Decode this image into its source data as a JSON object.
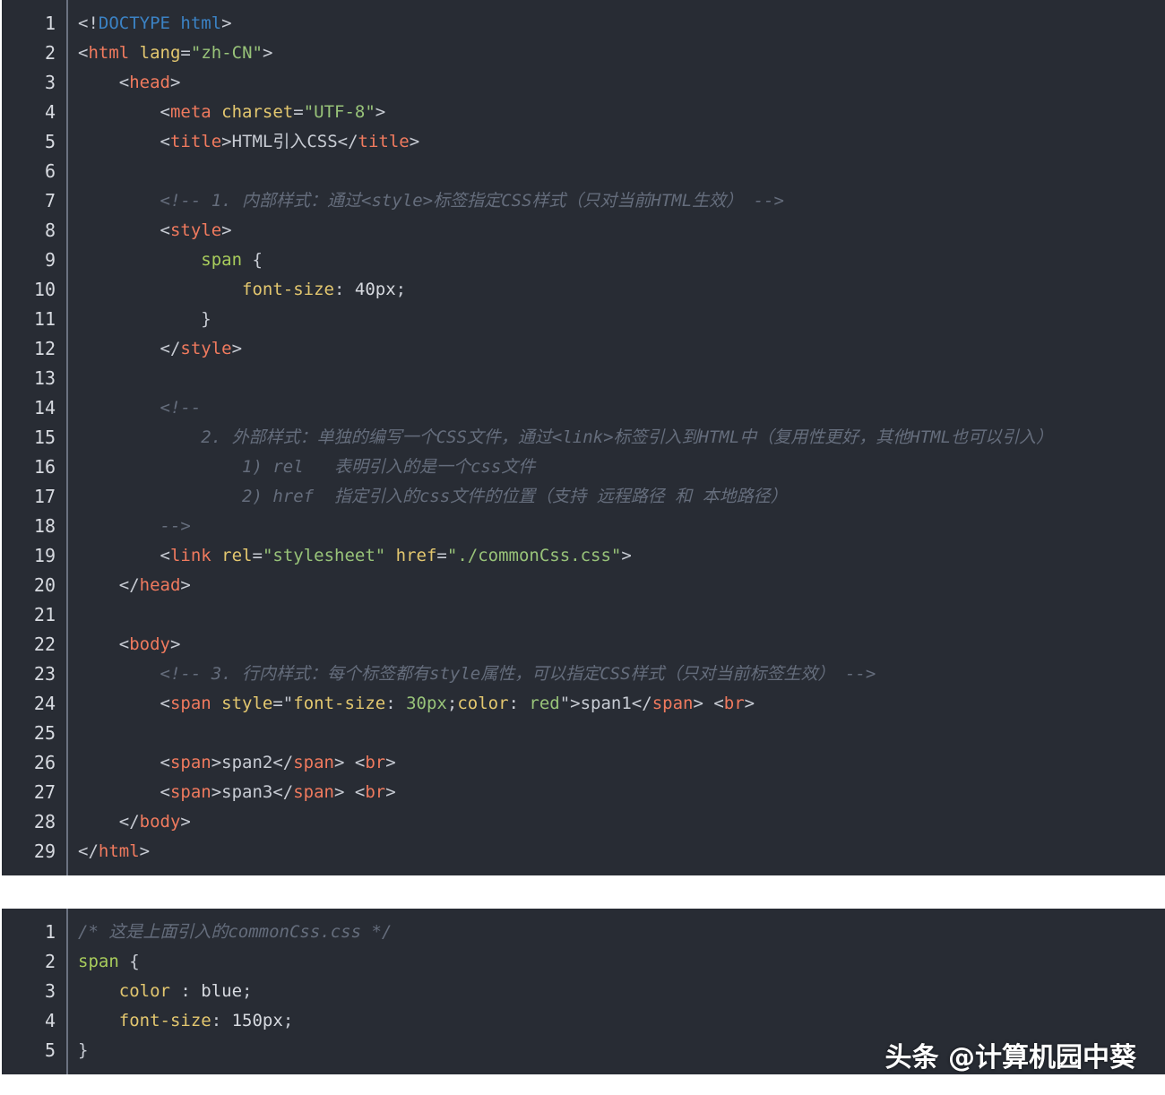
{
  "html_listing": {
    "line_numbers": [
      "1",
      "2",
      "3",
      "4",
      "5",
      "6",
      "7",
      "8",
      "9",
      "10",
      "11",
      "12",
      "13",
      "14",
      "15",
      "16",
      "17",
      "18",
      "19",
      "20",
      "21",
      "22",
      "23",
      "24",
      "25",
      "26",
      "27",
      "28",
      "29"
    ],
    "lines": [
      [
        [
          "p",
          "<!"
        ],
        [
          "dt",
          "DOCTYPE html"
        ],
        [
          "p",
          ">"
        ]
      ],
      [
        [
          "p",
          "<"
        ],
        [
          "t",
          "html"
        ],
        [
          "a",
          " lang"
        ],
        [
          "p",
          "="
        ],
        [
          "s",
          "\"zh-CN\""
        ],
        [
          "p",
          ">"
        ]
      ],
      [
        [
          "p",
          "    <"
        ],
        [
          "t",
          "head"
        ],
        [
          "p",
          ">"
        ]
      ],
      [
        [
          "p",
          "        <"
        ],
        [
          "t",
          "meta"
        ],
        [
          "a",
          " charset"
        ],
        [
          "p",
          "="
        ],
        [
          "s",
          "\"UTF-8\""
        ],
        [
          "p",
          ">"
        ]
      ],
      [
        [
          "p",
          "        <"
        ],
        [
          "t",
          "title"
        ],
        [
          "p",
          ">HTML引入CSS</"
        ],
        [
          "t",
          "title"
        ],
        [
          "p",
          ">"
        ]
      ],
      [],
      [
        [
          "c",
          "        <!-- 1. 内部样式：通过<style>标签指定CSS样式（只对当前HTML生效） -->"
        ]
      ],
      [
        [
          "p",
          "        <"
        ],
        [
          "t",
          "style"
        ],
        [
          "p",
          ">"
        ]
      ],
      [
        [
          "sel",
          "            span"
        ],
        [
          "p",
          " {"
        ]
      ],
      [
        [
          "prop",
          "                font-size"
        ],
        [
          "p",
          ": "
        ],
        [
          "val",
          "40px"
        ],
        [
          "p",
          ";"
        ]
      ],
      [
        [
          "p",
          "            }"
        ]
      ],
      [
        [
          "p",
          "        </"
        ],
        [
          "t",
          "style"
        ],
        [
          "p",
          ">"
        ]
      ],
      [],
      [
        [
          "c",
          "        <!--"
        ]
      ],
      [
        [
          "c",
          "            2. 外部样式：单独的编写一个CSS文件，通过<link>标签引入到HTML中（复用性更好，其他HTML也可以引入）"
        ]
      ],
      [
        [
          "c",
          "                1) rel   表明引入的是一个css文件"
        ]
      ],
      [
        [
          "c",
          "                2) href  指定引入的css文件的位置（支持 远程路径 和 本地路径）"
        ]
      ],
      [
        [
          "c",
          "        -->"
        ]
      ],
      [
        [
          "p",
          "        <"
        ],
        [
          "t",
          "link"
        ],
        [
          "a",
          " rel"
        ],
        [
          "p",
          "="
        ],
        [
          "s",
          "\"stylesheet\""
        ],
        [
          "a",
          " href"
        ],
        [
          "p",
          "="
        ],
        [
          "s",
          "\"./commonCss.css\""
        ],
        [
          "p",
          ">"
        ]
      ],
      [
        [
          "p",
          "    </"
        ],
        [
          "t",
          "head"
        ],
        [
          "p",
          ">"
        ]
      ],
      [],
      [
        [
          "p",
          "    <"
        ],
        [
          "t",
          "body"
        ],
        [
          "p",
          ">"
        ]
      ],
      [
        [
          "c",
          "        <!-- 3. 行内样式：每个标签都有style属性，可以指定CSS样式（只对当前标签生效） -->"
        ]
      ],
      [
        [
          "p",
          "        <"
        ],
        [
          "t",
          "span"
        ],
        [
          "a",
          " style"
        ],
        [
          "p",
          "=\""
        ],
        [
          "prop",
          "font-size"
        ],
        [
          "p",
          ": "
        ],
        [
          "s",
          "30px"
        ],
        [
          "p",
          ";"
        ],
        [
          "prop",
          "color"
        ],
        [
          "p",
          ": "
        ],
        [
          "s",
          "red"
        ],
        [
          "p",
          "\">span1</"
        ],
        [
          "t",
          "span"
        ],
        [
          "p",
          "> <"
        ],
        [
          "t",
          "br"
        ],
        [
          "p",
          ">"
        ]
      ],
      [],
      [
        [
          "p",
          "        <"
        ],
        [
          "t",
          "span"
        ],
        [
          "p",
          ">span2</"
        ],
        [
          "t",
          "span"
        ],
        [
          "p",
          "> <"
        ],
        [
          "t",
          "br"
        ],
        [
          "p",
          ">"
        ]
      ],
      [
        [
          "p",
          "        <"
        ],
        [
          "t",
          "span"
        ],
        [
          "p",
          ">span3</"
        ],
        [
          "t",
          "span"
        ],
        [
          "p",
          "> <"
        ],
        [
          "t",
          "br"
        ],
        [
          "p",
          ">"
        ]
      ],
      [
        [
          "p",
          "    </"
        ],
        [
          "t",
          "body"
        ],
        [
          "p",
          ">"
        ]
      ],
      [
        [
          "p",
          "</"
        ],
        [
          "t",
          "html"
        ],
        [
          "p",
          ">"
        ]
      ]
    ]
  },
  "css_listing": {
    "line_numbers": [
      "1",
      "2",
      "3",
      "4",
      "5"
    ],
    "lines": [
      [
        [
          "c",
          "/* 这是上面引入的commonCss.css */"
        ]
      ],
      [
        [
          "sel",
          "span"
        ],
        [
          "p",
          " {"
        ]
      ],
      [
        [
          "prop",
          "    color"
        ],
        [
          "p",
          " : "
        ],
        [
          "val",
          "blue"
        ],
        [
          "p",
          ";"
        ]
      ],
      [
        [
          "prop",
          "    font-size"
        ],
        [
          "p",
          ": "
        ],
        [
          "val",
          "150px"
        ],
        [
          "p",
          ";"
        ]
      ],
      [
        [
          "p",
          "}"
        ]
      ]
    ]
  },
  "watermark": "头条 @计算机园中葵",
  "colors": {
    "background": "#282c34",
    "tag": "#f07a5e",
    "attribute": "#e3c76f",
    "string": "#98c379",
    "comment": "#656d7c",
    "selector": "#a8cc5c"
  }
}
